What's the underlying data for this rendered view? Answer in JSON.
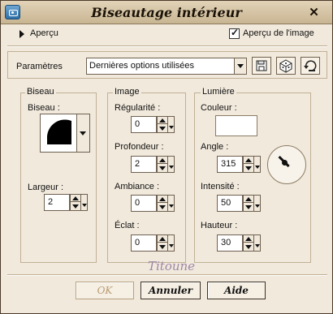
{
  "window": {
    "title": "Biseautage intérieur",
    "close_glyph": "✕",
    "app_icon": "camera-icon"
  },
  "preview": {
    "toggle_label": "Aperçu",
    "image_preview_label": "Aperçu de l'image",
    "image_preview_checked": true
  },
  "presets": {
    "label": "Paramètres",
    "selected": "Dernières options utilisées",
    "buttons": [
      "save-preset-icon",
      "randomize-icon",
      "reset-icon"
    ]
  },
  "biseau": {
    "title": "Biseau",
    "bevel_label": "Biseau :",
    "width_label": "Largeur :",
    "width_value": "2"
  },
  "image": {
    "title": "Image",
    "smoothness_label": "Régularité :",
    "smoothness_value": "0",
    "depth_label": "Profondeur :",
    "depth_value": "2",
    "ambience_label": "Ambiance :",
    "ambience_value": "0",
    "shininess_label": "Éclat :",
    "shininess_value": "0"
  },
  "light": {
    "title": "Lumière",
    "color_label": "Couleur :",
    "color_value": "#ffffff",
    "angle_label": "Angle :",
    "angle_value": "315",
    "intensity_label": "Intensité :",
    "intensity_value": "50",
    "elevation_label": "Hauteur :",
    "elevation_value": "30"
  },
  "watermark": "Titoune",
  "footer": {
    "ok": "OK",
    "cancel": "Annuler",
    "help": "Aide"
  }
}
